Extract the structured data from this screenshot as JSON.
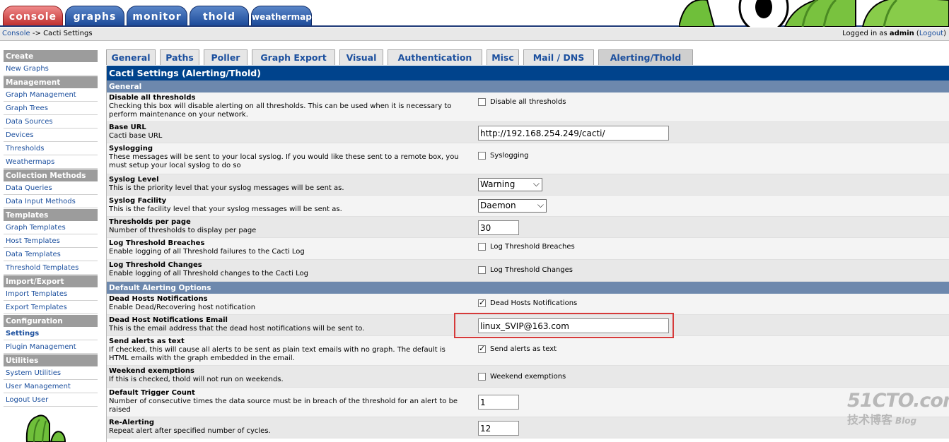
{
  "nav_tabs": [
    "console",
    "graphs",
    "monitor",
    "thold",
    "weathermap"
  ],
  "breadcrumb": {
    "home": "Console",
    "sep": "->",
    "current": "Cacti Settings"
  },
  "login": {
    "prefix": "Logged in as",
    "user": "admin",
    "logout": "Logout"
  },
  "sidebar": [
    {
      "type": "header",
      "label": "Create"
    },
    {
      "type": "item",
      "label": "New Graphs"
    },
    {
      "type": "header",
      "label": "Management"
    },
    {
      "type": "item",
      "label": "Graph Management"
    },
    {
      "type": "item",
      "label": "Graph Trees"
    },
    {
      "type": "item",
      "label": "Data Sources"
    },
    {
      "type": "item",
      "label": "Devices"
    },
    {
      "type": "item",
      "label": "Thresholds"
    },
    {
      "type": "item",
      "label": "Weathermaps"
    },
    {
      "type": "header",
      "label": "Collection Methods"
    },
    {
      "type": "item",
      "label": "Data Queries"
    },
    {
      "type": "item",
      "label": "Data Input Methods"
    },
    {
      "type": "header",
      "label": "Templates"
    },
    {
      "type": "item",
      "label": "Graph Templates"
    },
    {
      "type": "item",
      "label": "Host Templates"
    },
    {
      "type": "item",
      "label": "Data Templates"
    },
    {
      "type": "item",
      "label": "Threshold Templates"
    },
    {
      "type": "header",
      "label": "Import/Export"
    },
    {
      "type": "item",
      "label": "Import Templates"
    },
    {
      "type": "item",
      "label": "Export Templates"
    },
    {
      "type": "header",
      "label": "Configuration"
    },
    {
      "type": "item",
      "label": "Settings",
      "active": true
    },
    {
      "type": "item",
      "label": "Plugin Management"
    },
    {
      "type": "header",
      "label": "Utilities"
    },
    {
      "type": "item",
      "label": "System Utilities"
    },
    {
      "type": "item",
      "label": "User Management"
    },
    {
      "type": "item",
      "label": "Logout User"
    }
  ],
  "settings_tabs": [
    "General",
    "Paths",
    "Poller",
    "Graph Export",
    "Visual",
    "Authentication",
    "Misc",
    "Mail / DNS",
    "Alerting/Thold"
  ],
  "active_settings_tab": "Alerting/Thold",
  "panel_title": "Cacti Settings (Alerting/Thold)",
  "sections": {
    "general": "General",
    "default_alerting": "Default Alerting Options"
  },
  "rows": [
    {
      "title": "Disable all thresholds",
      "desc": "Checking this box will disable alerting on all thresholds. This can be used when it is necessary to perform maintenance on your network.",
      "control": "checkbox",
      "checked": false,
      "cb_label": "Disable all thresholds"
    },
    {
      "title": "Base URL",
      "desc": "Cacti base URL",
      "control": "text",
      "value": "http://192.168.254.249/cacti/"
    },
    {
      "title": "Syslogging",
      "desc": "These messages will be sent to your local syslog. If you would like these sent to a remote box, you must setup your local syslog to do so",
      "control": "checkbox",
      "checked": false,
      "cb_label": "Syslogging"
    },
    {
      "title": "Syslog Level",
      "desc": "This is the priority level that your syslog messages will be sent as.",
      "control": "select",
      "value": "Warning"
    },
    {
      "title": "Syslog Facility",
      "desc": "This is the facility level that your syslog messages will be sent as.",
      "control": "select",
      "value": "Daemon"
    },
    {
      "title": "Thresholds per page",
      "desc": "Number of thresholds to display per page",
      "control": "text",
      "value": "30"
    },
    {
      "title": "Log Threshold Breaches",
      "desc": "Enable logging of all Threshold failures to the Cacti Log",
      "control": "checkbox",
      "checked": false,
      "cb_label": "Log Threshold Breaches"
    },
    {
      "title": "Log Threshold Changes",
      "desc": "Enable logging of all Threshold changes to the Cacti Log",
      "control": "checkbox",
      "checked": false,
      "cb_label": "Log Threshold Changes"
    },
    {
      "title": "Dead Hosts Notifications",
      "desc": "Enable Dead/Recovering host notification",
      "control": "checkbox",
      "checked": true,
      "cb_label": "Dead Hosts Notifications"
    },
    {
      "title": "Dead Host Notifications Email",
      "desc": "This is the email address that the dead host notifications will be sent to.",
      "control": "text",
      "value": "linux_SVIP@163.com"
    },
    {
      "title": "Send alerts as text",
      "desc": "If checked, this will cause all alerts to be sent as plain text emails with no graph. The default is HTML emails with the graph embedded in the email.",
      "control": "checkbox",
      "checked": true,
      "cb_label": "Send alerts as text"
    },
    {
      "title": "Weekend exemptions",
      "desc": "If this is checked, thold will not run on weekends.",
      "control": "checkbox",
      "checked": false,
      "cb_label": "Weekend exemptions"
    },
    {
      "title": "Default Trigger Count",
      "desc": "Number of consecutive times the data source must be in breach of the threshold for an alert to be raised",
      "control": "text",
      "value": "1"
    },
    {
      "title": "Re-Alerting",
      "desc": "Repeat alert after specified number of cycles.",
      "control": "text",
      "value": "12"
    }
  ],
  "watermark": {
    "site": "51CTO.com",
    "sub": "技术博客",
    "blog": "Blog"
  },
  "colors": {
    "panel_title_bg": "#00438c",
    "section_bg": "#6d88ad",
    "link": "#1b4f9e",
    "highlight_box": "#d63a3a"
  }
}
